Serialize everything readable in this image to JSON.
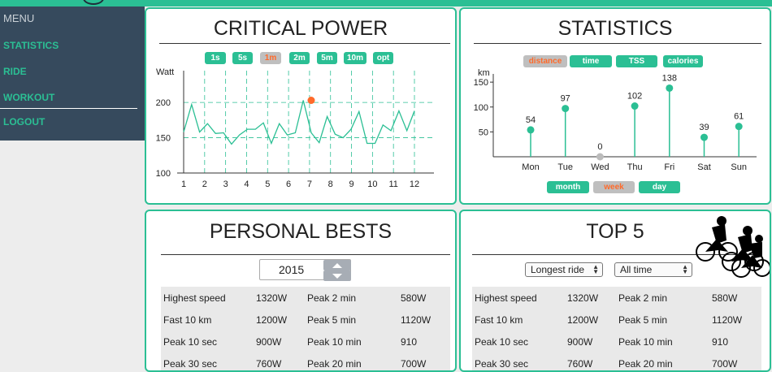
{
  "sidebar": {
    "menu_label": "MENU",
    "items": [
      {
        "label": "STATISTICS"
      },
      {
        "label": "RIDE"
      },
      {
        "label": "WORKOUT"
      },
      {
        "label": "LOGOUT"
      }
    ]
  },
  "critical_power": {
    "title": "CRITICAL POWER",
    "buttons": [
      "1s",
      "5s",
      "1m",
      "2m",
      "5m",
      "10m",
      "opt"
    ],
    "selected": "1m",
    "ylabel": "Watt",
    "chart_data": {
      "type": "line",
      "x": [
        1,
        1.38,
        1.76,
        2.14,
        2.52,
        2.9,
        3.28,
        3.66,
        4.04,
        4.42,
        4.8,
        5.18,
        5.56,
        5.94,
        6.32,
        6.7,
        7.08,
        7.46,
        7.84,
        8.22,
        8.6,
        8.98,
        9.36,
        9.74,
        10.12,
        10.5,
        10.88,
        11.26,
        11.64,
        12
      ],
      "y": [
        158,
        197,
        158,
        170,
        156,
        157,
        141,
        154,
        162,
        162,
        171,
        142,
        170,
        154,
        157,
        203,
        157,
        143,
        180,
        155,
        150,
        162,
        187,
        142,
        142,
        168,
        160,
        188,
        160,
        188
      ],
      "xticks": [
        1,
        2,
        3,
        4,
        5,
        6,
        7,
        8,
        9,
        10,
        11,
        12
      ],
      "yticks": [
        100,
        150,
        200
      ],
      "ylim": [
        100,
        245
      ],
      "xlim": [
        1,
        12
      ],
      "highlight": {
        "x": 7.08,
        "y": 203
      },
      "grid": true,
      "colors": {
        "line": "#2bbf94",
        "highlight": "#ff6a2a"
      }
    }
  },
  "statistics": {
    "title": "STATISTICS",
    "buttons": [
      "distance",
      "time",
      "TSS",
      "calories"
    ],
    "selected": "distance",
    "period_buttons": [
      "month",
      "week",
      "day"
    ],
    "period_selected": "week",
    "ylabel": "km",
    "chart_data": {
      "type": "bar",
      "categories": [
        "Mon",
        "Tue",
        "Wed",
        "Thu",
        "Fri",
        "Sat",
        "Sun"
      ],
      "values": [
        54,
        97,
        0,
        102,
        138,
        39,
        61
      ],
      "yticks": [
        50,
        100,
        150
      ],
      "ylim": [
        0,
        160
      ],
      "colors": {
        "bar": "#2bbf94",
        "zero": "#bbbbbb"
      }
    }
  },
  "personal_bests": {
    "title": "PERSONAL BESTS",
    "year": "2015",
    "rows": [
      [
        "Highest speed",
        "1320W",
        "Peak 2 min",
        "580W"
      ],
      [
        "Fast 10 km",
        "1200W",
        "Peak 5 min",
        "1120W"
      ],
      [
        "Peak 10 sec",
        "900W",
        "Peak 10 min",
        "910"
      ],
      [
        "Peak 30 sec",
        "760W",
        "Peak 20 min",
        "700W"
      ]
    ]
  },
  "top5": {
    "title": "TOP 5",
    "filter1": "Longest ride",
    "filter2": "All time",
    "rows": [
      [
        "Highest speed",
        "1320W",
        "Peak 2 min",
        "580W"
      ],
      [
        "Fast 10 km",
        "1200W",
        "Peak 5 min",
        "1120W"
      ],
      [
        "Peak 10 sec",
        "900W",
        "Peak 10 min",
        "910"
      ],
      [
        "Peak 30 sec",
        "760W",
        "Peak 20 min",
        "700W"
      ]
    ]
  },
  "colors": {
    "accent": "#2bbf94",
    "selected_text": "#ff6a2a",
    "sidebar": "#364a5d"
  }
}
